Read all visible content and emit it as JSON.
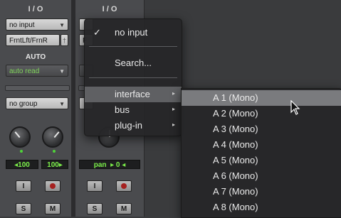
{
  "strip1": {
    "io_label": "I / O",
    "input_value": "no input",
    "output_value": "FrntLft/FrnR",
    "auto_label": "AUTO",
    "auto_value": "auto read",
    "group_value": "no group",
    "pan_left": "100",
    "pan_right": "100",
    "input_btn": "I",
    "solo_btn": "S",
    "mute_btn": "M"
  },
  "strip2": {
    "io_label": "I / O",
    "output_prefix": "F",
    "pan_label": "pan",
    "pan_value": "0",
    "input_btn": "I",
    "solo_btn": "S",
    "mute_btn": "M"
  },
  "menu": {
    "checkmark": "✓",
    "items": [
      {
        "label": "no input",
        "checked": true
      },
      {
        "label": "Search..."
      },
      {
        "label": "interface",
        "submenu": true
      },
      {
        "label": "bus",
        "submenu": true
      },
      {
        "label": "plug-in",
        "submenu": true
      }
    ],
    "chevron": "▸"
  },
  "submenu": {
    "items": [
      "A 1 (Mono)",
      "A 2 (Mono)",
      "A 3 (Mono)",
      "A 4 (Mono)",
      "A 5 (Mono)",
      "A 6 (Mono)",
      "A 7 (Mono)",
      "A 8 (Mono)"
    ],
    "highlighted_index": 0
  },
  "colors": {
    "auto_text": "#7fd35a",
    "pan_text": "#7cf04a",
    "record": "#a5201f",
    "highlight": "#7a7b7e"
  }
}
